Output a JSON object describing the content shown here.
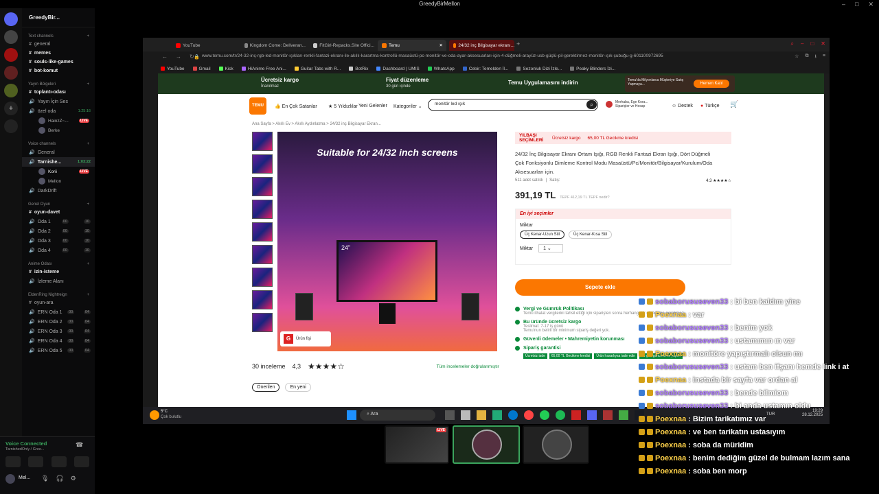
{
  "window_title": "GreedyBirMellon",
  "discord": {
    "server_name": "GreedyBir...",
    "categories": [
      {
        "name": "Text channels",
        "channels": [
          "general",
          "memes",
          "souls-like-games",
          "bot-komut"
        ]
      },
      {
        "name": "Yayın Bölgeleri",
        "channels": [
          "toplantı-odası",
          "Yayın İçin Ses",
          "özel oda"
        ]
      },
      {
        "name": "Voice channels",
        "channels": [
          "General",
          "Tarnishe...",
          "DarkDrift"
        ]
      },
      {
        "name": "Genel Oyun",
        "channels": [
          "oyun-davet",
          "Oda 1",
          "Oda 2",
          "Oda 3",
          "Oda 4"
        ]
      },
      {
        "name": "Anime Odası",
        "channels": [
          "izin-isteme",
          "İzleme Alanı"
        ]
      },
      {
        "name": "EldenRing Nightreign",
        "channels": [
          "oyun-ara",
          "ERN Oda 1",
          "ERN Oda 2",
          "ERN Oda 3",
          "ERN Oda 4",
          "ERN Oda 5"
        ]
      }
    ],
    "ozel_oda_time": "1:25:16",
    "ozel_oda_users": [
      "HainzZ~...",
      "Berke"
    ],
    "tarnished_time": "1:03:22",
    "tarnished_users": [
      "Korii",
      "Mellon"
    ],
    "live_label": "LIVE",
    "room_counts": [
      "00",
      "10"
    ],
    "ern_counts": [
      "00",
      "04"
    ],
    "voice_connected": "Voice Connected",
    "voice_sub": "TarnishedOnly / Gree...",
    "user_short": "Mel..."
  },
  "browser": {
    "tabs": [
      "YouTube",
      "Kingdom Come: Deliveran...",
      "FitGirl-Repacks.Site Offici...",
      "Temu",
      "24/32 inç Bilgisayar ekranı..."
    ],
    "url": "www.temu.com/tr/24-32-inç-rgb-led-monitör-ışıkları-renkli-fantazi-ekranı-ile-akıllı-karartma-kontrollü-masaüstü-pc-monitör-ve-oda-ayar-aksesuarları-için-4-düğmeli-arayüz-usb-güçlü-pil-gerektirmez-monitör-ışık-çubuğu-g-601100972695",
    "bookmarks": [
      "YouTube",
      "Gmail",
      "Kick",
      "HiAnime Free Ani...",
      "Guitar Tabs with R...",
      "BotRix",
      "Dashboard | UMIS",
      "WhatsApp",
      "Cebir: Temelden İl...",
      "Sezonluk Dizi İzle...",
      "Peaky Blinders İzi..."
    ]
  },
  "temu": {
    "promo": [
      "Ücretsiz kargo",
      "İnanılmaz",
      "Fiyat düzenleme",
      "30 gün içinde",
      "Temu Uygulamasını indirin",
      "Temu'da Milyonlarca Müşteriye Satış Yapmaya...",
      "Hemen Katıl"
    ],
    "nav": [
      "En Çok Satanlar",
      "5 Yıldızlılar",
      "Yeni Gelenler",
      "Kategoriler"
    ],
    "search_value": "monitör led ışık",
    "account": "Merhaba, Ege Kora... Siparişler ve Hesap",
    "support": "Destek",
    "language": "Türkçe",
    "breadcrumb": "Ana Sayfa  >  Akıllı Ev  >  Akıllı Aydınlatma  >  24/32 inç Bilgisayar Ekran...",
    "image_caption": "Suitable for 24/32 inch screens",
    "image_size_label": "24\"",
    "badge": "Ürün fişi",
    "badge_letter": "G",
    "yilbasi": "YILBAŞI SEÇİMLERİ",
    "free_shipping": "Ücretsiz kargo",
    "delay_credit": "65,00 TL Gecikme kredisi",
    "product_title": "24/32 İnç Bilgisayar Ekranı Ortam Işığı, RGB Renkli Fantazi Ekran Işığı, Dört Düğmeli Çok Fonksiyonlu Dimleme Kontrol Modu Masaüstü/Pc/Monitör/Bilgisayar/Kurulum/Oda Aksesuarları için.",
    "sold": "511 adet satıldı",
    "seller": "Satış:",
    "rating": "4.3",
    "price": "391,19 TL",
    "old_price": "TEPF 412,19 TL TEPF nedir?",
    "best_choices": "En iyi seçimler",
    "quantity_label": "Miktar",
    "options": [
      "Üç Kenar-Uzun Stil",
      "Üç Kenar-Kısa Stil"
    ],
    "quantity": "1",
    "cart_button": "Sepete ekle",
    "features": [
      {
        "title": "Vergi ve Gümrük Politikası",
        "sub": "Temu ithalat vergilerini tahsil ettiği için siparişten sonra herhangi bir ek ödeme gerekmez."
      },
      {
        "title": "Bu üründe ücretsiz kargo",
        "sub": "Teslimat: 7-17 iş günü"
      },
      {
        "title": "Güvenli ödemeler • Mahremiyetin korunması",
        "sub": ""
      },
      {
        "title": "Sipariş garantisi",
        "sub": ""
      }
    ],
    "delivery_note": "Temu'nun belirli bir minimum sipariş değeri yok.",
    "guarantee_tags": [
      "Ücretsiz iade",
      "65,00 TL Gecikme kredisi",
      "Ürün hasarlıysa iade edin",
      "15 gün güncelleme yapılır"
    ],
    "reviews": "30 inceleme",
    "reviews_rating": "4,3",
    "verified": "Tüm incelemeler doğrulanmıştır",
    "filters": [
      "Önerilen",
      "En yeni"
    ]
  },
  "taskbar": {
    "weather": "5°C",
    "weather_sub": "Çok bulutlu",
    "search": "Ara",
    "lang": "TUR",
    "time": "19:29",
    "date": "28.12.2025"
  },
  "chat": [
    {
      "user": "sobaborususeven33",
      "text": "bi ben kaldım yine",
      "style": "u1"
    },
    {
      "user": "Poexnaa",
      "text": "var",
      "style": "u2"
    },
    {
      "user": "sobaborususeven33",
      "text": "benim yok",
      "style": "u1"
    },
    {
      "user": "sobaborususeven33",
      "text": "ustamımın ın var",
      "style": "u1"
    },
    {
      "user": "Poexnaa",
      "text": "monitöre yapıştırmalı olsun mı",
      "style": "u2"
    },
    {
      "user": "sobaborususeven33",
      "text": "ustam ben ifşanı hemde link i at",
      "style": "u1"
    },
    {
      "user": "Poexnaa",
      "text": "instada bir sayfa var ordan al",
      "style": "u2"
    },
    {
      "user": "sobaborususeven33",
      "text": "bende bilmiom",
      "style": "u1"
    },
    {
      "user": "sobaborususeven33",
      "text": "bi anda ustamın oldu",
      "style": "u1"
    },
    {
      "user": "Poexnaa",
      "text": "Bizim tarikatımız var",
      "style": "u2"
    },
    {
      "user": "Poexnaa",
      "text": "ve ben tarikatın ustasıyım",
      "style": "u2"
    },
    {
      "user": "Poexnaa",
      "text": "soba da müridim",
      "style": "u2"
    },
    {
      "user": "Poexnaa",
      "text": "benim dediğim güzel de bulmam lazım sana",
      "style": "u2"
    },
    {
      "user": "Poexnaa",
      "text": "soba ben morp",
      "style": "u2"
    }
  ],
  "stream_live": "LIVE"
}
